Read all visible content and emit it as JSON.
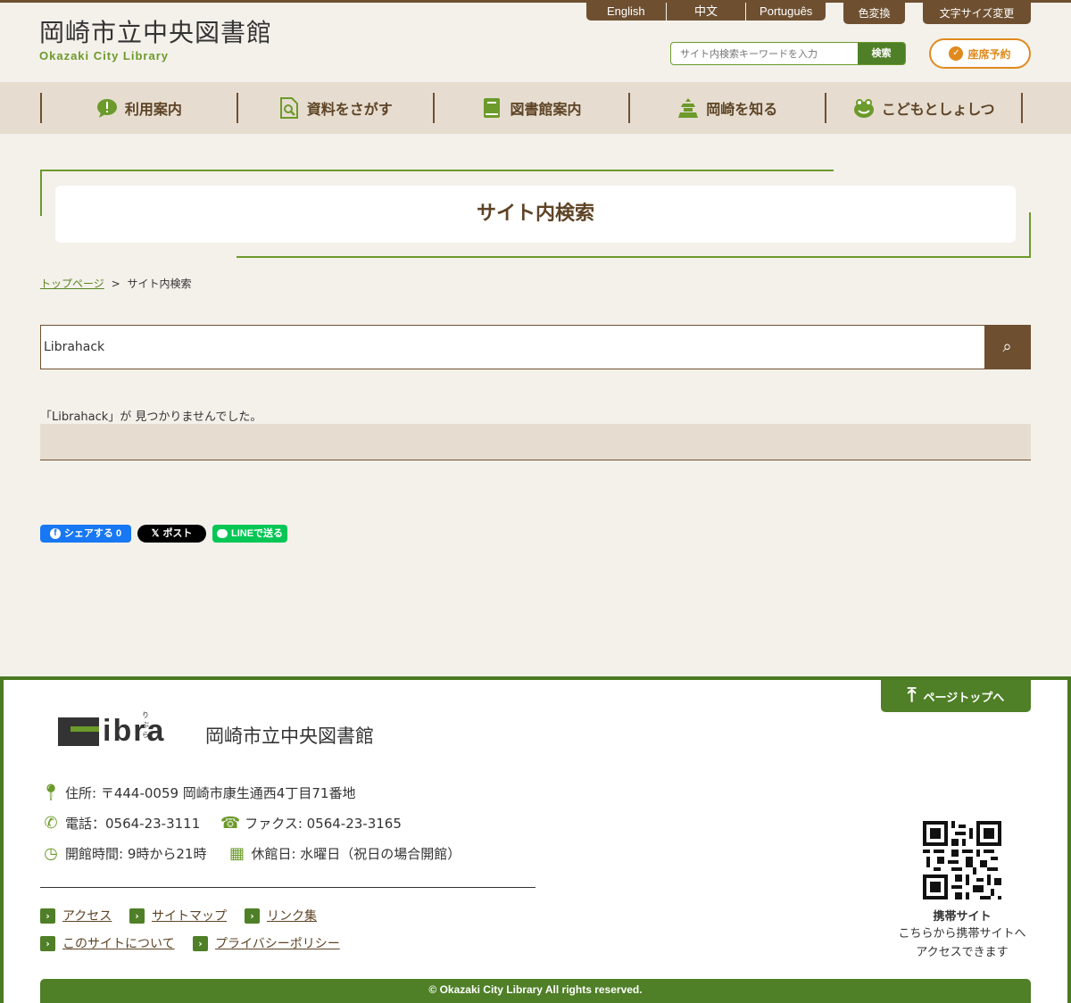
{
  "header": {
    "logo_jp": "岡崎市立中央図書館",
    "logo_en": "Okazaki City Library",
    "lang_links": [
      "English",
      "中文",
      "Português"
    ],
    "color_change": "色変換",
    "font_size": "文字サイズ変更",
    "search_placeholder": "サイト内検索キーワードを入力",
    "search_button": "検索",
    "reserve_label": "座席予約"
  },
  "nav": {
    "items": [
      {
        "label": "利用案内",
        "icon": "speech-bubble-icon"
      },
      {
        "label": "資料をさがす",
        "icon": "document-search-icon"
      },
      {
        "label": "図書館案内",
        "icon": "book-icon"
      },
      {
        "label": "岡崎を知る",
        "icon": "castle-icon"
      },
      {
        "label": "こどもとしょしつ",
        "icon": "frog-icon"
      }
    ]
  },
  "page": {
    "title": "サイト内検索",
    "breadcrumb_home": "トップページ",
    "breadcrumb_sep": ">",
    "breadcrumb_current": "サイト内検索",
    "search_value": "Librahack",
    "search_button_glyph": "⌕",
    "result_message": "「Librahack」が 見つかりませんでした。"
  },
  "share": {
    "facebook": "シェアする 0",
    "x": "ポスト",
    "line": "LINEで送る"
  },
  "footer": {
    "pagetop": "ページトップへ",
    "logo_word": "ibra",
    "logo_ruby": "りぶら",
    "library_name": "岡崎市立中央図書館",
    "address": "住所: 〒444-0059 岡崎市康生通西4丁目71番地",
    "phone": "電話：0564-23-3111",
    "fax": "ファクス: 0564-23-3165",
    "hours": "開館時間: 9時から21時",
    "closed": "休館日: 水曜日（祝日の場合開館）",
    "links_row1": [
      "アクセス",
      "サイトマップ",
      "リンク集"
    ],
    "links_row2": [
      "このサイトについて",
      "プライバシーポリシー"
    ],
    "mobile_title": "携帯サイト",
    "mobile_text": "こちらから携帯サイトへアクセスできます",
    "copyright": "© Okazaki City Library All rights reserved."
  },
  "colors": {
    "brown": "#6e5031",
    "green": "#4f7f27",
    "orange": "#e08a1e",
    "background": "#f4f1eb"
  }
}
